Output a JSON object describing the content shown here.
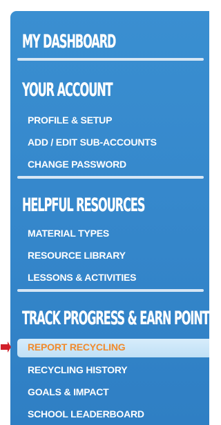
{
  "sidebar": {
    "sections": [
      {
        "heading": "MY DASHBOARD",
        "items": []
      },
      {
        "heading": "YOUR ACCOUNT",
        "items": [
          "PROFILE & SETUP",
          "ADD / EDIT SUB-ACCOUNTS",
          "CHANGE PASSWORD"
        ]
      },
      {
        "heading": "HELPFUL RESOURCES",
        "items": [
          "MATERIAL TYPES",
          "RESOURCE LIBRARY",
          "LESSONS & ACTIVITIES"
        ]
      },
      {
        "heading": "TRACK PROGRESS & EARN POINTS",
        "items": [
          "REPORT RECYCLING",
          "RECYCLING HISTORY",
          "GOALS & IMPACT",
          "SCHOOL LEADERBOARD"
        ]
      }
    ],
    "active_item": "REPORT RECYCLING"
  },
  "colors": {
    "panel_bg": "#3587cb",
    "text": "#ffffff",
    "active_text": "#f08a2c",
    "active_bg": "#cfe7f9",
    "pointer": "#d11f2a"
  },
  "icons": {
    "pointer": "red-arrow-pointer-icon"
  }
}
